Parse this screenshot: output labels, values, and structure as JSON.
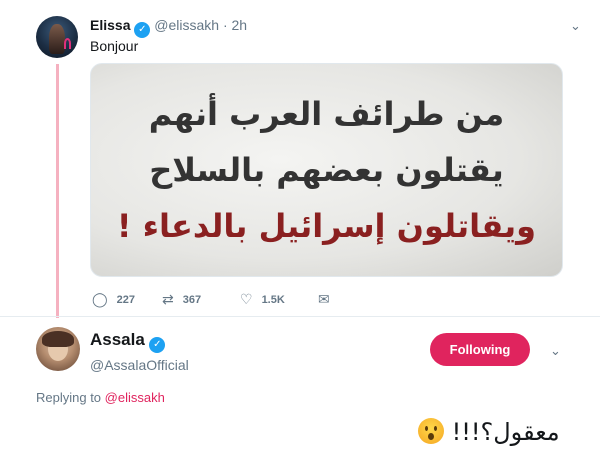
{
  "tweet": {
    "author_name": "Elissa",
    "author_handle": "@elissakh",
    "time": "· 2h",
    "text": "Bonjour",
    "image_text_lines": [
      "من طرائف العرب أنهم",
      "يقتلون بعضهم بالسلاح",
      "ويقاتلون إسرائيل بالدعاء !"
    ],
    "actions": {
      "replies": "227",
      "retweets": "367",
      "likes": "1.5K"
    }
  },
  "reply": {
    "author_name": "Assala",
    "author_handle": "@AssalaOfficial",
    "follow_label": "Following",
    "replying_prefix": "Replying to",
    "replying_to": "@elissakh",
    "text": "معقول؟!!!"
  },
  "icons": {
    "verified": "verified-badge-icon",
    "caret": "chevron-down-icon",
    "reply": "reply-icon",
    "retweet": "retweet-icon",
    "like": "heart-icon",
    "dm": "envelope-icon"
  },
  "colors": {
    "accent": "#e0245e",
    "verified": "#1da1f2",
    "thread_line": "#f5b1c0",
    "muted": "#657786"
  }
}
